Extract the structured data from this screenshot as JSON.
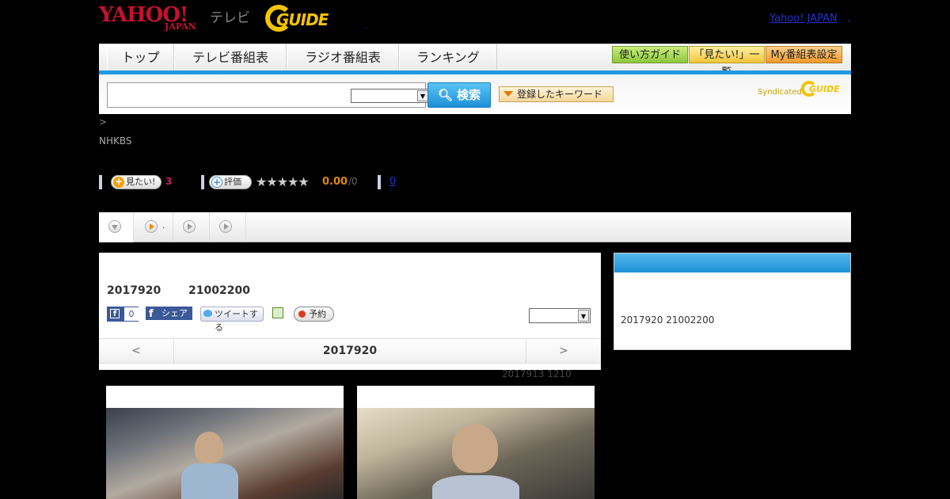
{
  "header": {
    "yahoo_logo": "YAHOO!",
    "yahoo_japan": "JAPAN",
    "tv_label": "テレビ",
    "gguide_logo": "GUIDE",
    "header_dot": ".",
    "yahoo_japan_link": "Yahoo! JAPAN",
    "yahoo_dot": "."
  },
  "nav": {
    "tabs": [
      {
        "label": "トップ"
      },
      {
        "label": "テレビ番組表"
      },
      {
        "label": "ラジオ番組表"
      },
      {
        "label": "ランキング"
      }
    ],
    "buttons": [
      {
        "label": "使い方ガイド",
        "color": "#9fd43a"
      },
      {
        "label": "「見たい!」一覧",
        "color": "#f7d24a"
      },
      {
        "label": "My番組表設定",
        "color": "#f5a03c"
      }
    ]
  },
  "search": {
    "input_value": "",
    "select_value": "",
    "button_label": "検索",
    "keyword_button": "登録したキーワード",
    "syndicated": "Syndicated",
    "synd_logo": "GUIDE"
  },
  "breadcrumb": ">",
  "channel": "NHKBS",
  "actions": {
    "mitai_label": "見たい!",
    "mitai_count": "3",
    "rating_label": "評価",
    "stars": "★★★★★",
    "rating_score": "0.00",
    "rating_count": "/0",
    "comment_count": "0"
  },
  "tabstrip": {
    "tab2_label": "."
  },
  "program": {
    "airdate": "2017920",
    "airtime": "21002200",
    "fb_like_count": "0",
    "fb_share_label": "シェア",
    "tweet_label": "ツイートする",
    "reserve_label": "予約",
    "select_value": "",
    "date_prev": "<",
    "date_current": "2017920",
    "date_next": ">",
    "prev_airing": "2017913  1210"
  },
  "side": {
    "text": "2017920  21002200"
  },
  "colors": {
    "accent_blue": "#1e9be0",
    "yahoo_red": "#c8102e",
    "gguide_yellow": "#f5c400",
    "link_blue": "#2233cc"
  }
}
